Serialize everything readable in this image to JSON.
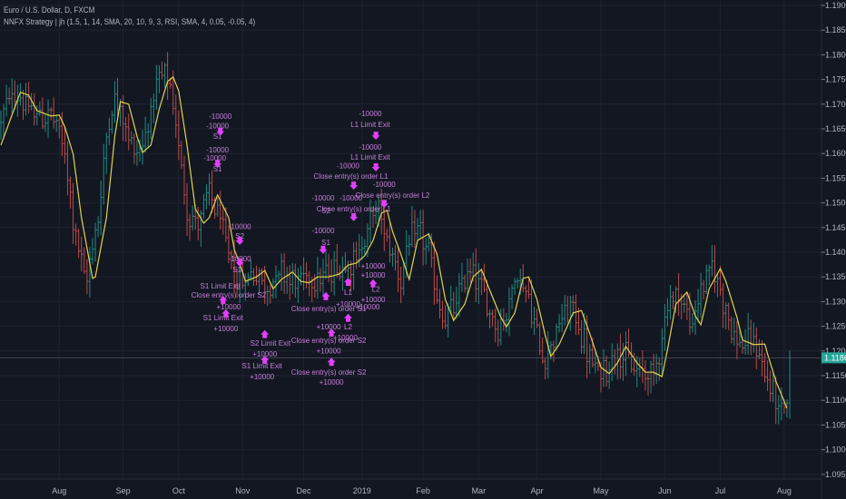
{
  "legend": {
    "symbol": "Euro / U.S. Dollar, D, FXCM",
    "study": "NNFX Strategy | jh (1.5, 1, 14, SMA, 20, 10, 9, 3, RSI, SMA, 4, 0.05, -0.05, 4)"
  },
  "colors": {
    "background": "#131722",
    "grid": "#1f2330",
    "up": "#22a094",
    "down": "#d9534f",
    "sma": "#e0d44a",
    "signal": "#e040fb",
    "last_price": "#26a69a"
  },
  "chart_data": {
    "type": "ohlc",
    "title": "Euro / U.S. Dollar, D, FXCM",
    "ylim": [
      1.095,
      1.19
    ],
    "price_ticks": [
      "1.19000",
      "1.18500",
      "1.18000",
      "1.17500",
      "1.17000",
      "1.16500",
      "1.16000",
      "1.15500",
      "1.15000",
      "1.14500",
      "1.14000",
      "1.13500",
      "1.13000",
      "1.12500",
      "1.12000",
      "1.11500",
      "1.11000",
      "1.10500",
      "1.10000",
      "1.09500"
    ],
    "time_ticks": [
      {
        "label": "Aug",
        "bar": 21
      },
      {
        "label": "Sep",
        "bar": 44
      },
      {
        "label": "Oct",
        "bar": 64
      },
      {
        "label": "Nov",
        "bar": 87
      },
      {
        "label": "Dec",
        "bar": 109
      },
      {
        "label": "2019",
        "bar": 130
      },
      {
        "label": "Feb",
        "bar": 152
      },
      {
        "label": "Mar",
        "bar": 172
      },
      {
        "label": "Apr",
        "bar": 193
      },
      {
        "label": "May",
        "bar": 216
      },
      {
        "label": "Jun",
        "bar": 239
      },
      {
        "label": "Jul",
        "bar": 259
      },
      {
        "label": "Aug",
        "bar": 282
      }
    ],
    "bar_count": 285,
    "last_price": "1.11861",
    "last_close": 1.11861,
    "sma_line": [
      [
        0,
        1.1617
      ],
      [
        7,
        1.1724
      ],
      [
        10,
        1.1718
      ],
      [
        13,
        1.1687
      ],
      [
        18,
        1.1676
      ],
      [
        21,
        1.1678
      ],
      [
        23,
        1.1654
      ],
      [
        26,
        1.1599
      ],
      [
        29,
        1.147
      ],
      [
        33,
        1.1347
      ],
      [
        34,
        1.135
      ],
      [
        38,
        1.147
      ],
      [
        41,
        1.1635
      ],
      [
        43,
        1.1705
      ],
      [
        46,
        1.17
      ],
      [
        49,
        1.1635
      ],
      [
        51,
        1.1602
      ],
      [
        54,
        1.1617
      ],
      [
        57,
        1.169
      ],
      [
        60,
        1.1746
      ],
      [
        62,
        1.1755
      ],
      [
        64,
        1.1727
      ],
      [
        67,
        1.1617
      ],
      [
        70,
        1.1488
      ],
      [
        73,
        1.1459
      ],
      [
        75,
        1.147
      ],
      [
        78,
        1.1516
      ],
      [
        82,
        1.147
      ],
      [
        84,
        1.1406
      ],
      [
        87,
        1.136
      ],
      [
        88,
        1.1341
      ],
      [
        92,
        1.135
      ],
      [
        95,
        1.1363
      ],
      [
        98,
        1.1326
      ],
      [
        101,
        1.1345
      ],
      [
        105,
        1.136
      ],
      [
        108,
        1.1341
      ],
      [
        111,
        1.1338
      ],
      [
        114,
        1.135
      ],
      [
        118,
        1.135
      ],
      [
        122,
        1.1356
      ],
      [
        125,
        1.1374
      ],
      [
        128,
        1.1378
      ],
      [
        131,
        1.1393
      ],
      [
        134,
        1.1424
      ],
      [
        137,
        1.1479
      ],
      [
        139,
        1.1485
      ],
      [
        141,
        1.1442
      ],
      [
        144,
        1.1396
      ],
      [
        147,
        1.1345
      ],
      [
        150,
        1.1424
      ],
      [
        154,
        1.1437
      ],
      [
        157,
        1.1396
      ],
      [
        160,
        1.1304
      ],
      [
        163,
        1.1262
      ],
      [
        167,
        1.1295
      ],
      [
        170,
        1.135
      ],
      [
        173,
        1.1365
      ],
      [
        176,
        1.1323
      ],
      [
        180,
        1.1268
      ],
      [
        182,
        1.1249
      ],
      [
        185,
        1.1277
      ],
      [
        188,
        1.1347
      ],
      [
        190,
        1.135
      ],
      [
        193,
        1.1304
      ],
      [
        196,
        1.1231
      ],
      [
        198,
        1.1189
      ],
      [
        201,
        1.1213
      ],
      [
        206,
        1.1277
      ],
      [
        209,
        1.1282
      ],
      [
        212,
        1.1235
      ],
      [
        216,
        1.1167
      ],
      [
        219,
        1.1154
      ],
      [
        222,
        1.1176
      ],
      [
        225,
        1.1209
      ],
      [
        229,
        1.1176
      ],
      [
        232,
        1.1157
      ],
      [
        235,
        1.1157
      ],
      [
        238,
        1.1148
      ],
      [
        240,
        1.1203
      ],
      [
        243,
        1.1295
      ],
      [
        247,
        1.1319
      ],
      [
        250,
        1.1271
      ],
      [
        252,
        1.1253
      ],
      [
        255,
        1.1326
      ],
      [
        259,
        1.1367
      ],
      [
        261,
        1.1341
      ],
      [
        265,
        1.1268
      ],
      [
        267,
        1.1222
      ],
      [
        271,
        1.1213
      ],
      [
        275,
        1.1214
      ],
      [
        276,
        1.1194
      ],
      [
        279,
        1.1139
      ],
      [
        283,
        1.1084
      ]
    ],
    "annotations": [
      {
        "text": "-10000",
        "bar": 79,
        "price": 1.1676
      },
      {
        "text": "-10000",
        "bar": 78,
        "price": 1.1656
      },
      {
        "text": "S1",
        "bar": 78,
        "price": 1.1635
      },
      {
        "text": "-10000",
        "bar": 78,
        "price": 1.1608
      },
      {
        "text": "-10000",
        "bar": 77,
        "price": 1.1591
      },
      {
        "text": "S1",
        "bar": 78,
        "price": 1.1569
      },
      {
        "text": "-10000",
        "bar": 86,
        "price": 1.1452
      },
      {
        "text": "S2",
        "bar": 86,
        "price": 1.1433
      },
      {
        "text": "-10000",
        "bar": 86,
        "price": 1.1387
      },
      {
        "text": "S1",
        "bar": 85,
        "price": 1.1365
      },
      {
        "text": "S1 Limit Exit",
        "bar": 79,
        "price": 1.1332
      },
      {
        "text": "Close entry(s) order S2",
        "bar": 82,
        "price": 1.1314
      },
      {
        "text": "+10000",
        "bar": 82,
        "price": 1.129
      },
      {
        "text": "S1 Limit Exit",
        "bar": 80,
        "price": 1.1268
      },
      {
        "text": "+10000",
        "bar": 81,
        "price": 1.1246
      },
      {
        "text": "S2 Limit Exit",
        "bar": 97,
        "price": 1.1216
      },
      {
        "text": "+10000",
        "bar": 95,
        "price": 1.1194
      },
      {
        "text": "S1 Limit Exit",
        "bar": 94,
        "price": 1.117
      },
      {
        "text": "+10000",
        "bar": 94,
        "price": 1.1148
      },
      {
        "text": "-10000",
        "bar": 133,
        "price": 1.1681
      },
      {
        "text": "L1 Limit Exit",
        "bar": 133,
        "price": 1.1659
      },
      {
        "text": "-10000",
        "bar": 133,
        "price": 1.1613
      },
      {
        "text": "L1 Limit Exit",
        "bar": 133,
        "price": 1.1593
      },
      {
        "text": "-10000",
        "bar": 125,
        "price": 1.1576
      },
      {
        "text": "Close entry(s) order L1",
        "bar": 126,
        "price": 1.1554
      },
      {
        "text": "-10000",
        "bar": 138,
        "price": 1.1538
      },
      {
        "text": "-10000",
        "bar": 116,
        "price": 1.151
      },
      {
        "text": "-10000",
        "bar": 126,
        "price": 1.151
      },
      {
        "text": "Close entry(s) order L2",
        "bar": 141,
        "price": 1.1516
      },
      {
        "text": "S2",
        "bar": 117,
        "price": 1.1485
      },
      {
        "text": "Close entry(s) order L1",
        "bar": 127,
        "price": 1.1488
      },
      {
        "text": "-10000",
        "bar": 116,
        "price": 1.1444
      },
      {
        "text": "S1",
        "bar": 117,
        "price": 1.142
      },
      {
        "text": "+10000",
        "bar": 134,
        "price": 1.1372
      },
      {
        "text": "+10000",
        "bar": 134,
        "price": 1.1354
      },
      {
        "text": "L1",
        "bar": 125,
        "price": 1.1319
      },
      {
        "text": "L2",
        "bar": 135,
        "price": 1.1326
      },
      {
        "text": "+10000",
        "bar": 134,
        "price": 1.1304
      },
      {
        "text": "+10000",
        "bar": 132,
        "price": 1.129
      },
      {
        "text": "+10000",
        "bar": 125,
        "price": 1.1295
      },
      {
        "text": "Close entry(s) order S1",
        "bar": 118,
        "price": 1.1286
      },
      {
        "text": "+10000",
        "bar": 118,
        "price": 1.1249
      },
      {
        "text": "L2",
        "bar": 125,
        "price": 1.1249
      },
      {
        "text": "+10000",
        "bar": 124,
        "price": 1.1227
      },
      {
        "text": "Close entry(s) order S2",
        "bar": 118,
        "price": 1.1222
      },
      {
        "text": "+10000",
        "bar": 118,
        "price": 1.1201
      },
      {
        "text": "Close entry(s) order S2",
        "bar": 118,
        "price": 1.1157
      },
      {
        "text": "+10000",
        "bar": 119,
        "price": 1.1137
      }
    ],
    "signal_arrows": [
      {
        "bar": 79,
        "price": 1.1643,
        "dir": "down"
      },
      {
        "bar": 78,
        "price": 1.1578,
        "dir": "down"
      },
      {
        "bar": 86,
        "price": 1.1422,
        "dir": "down"
      },
      {
        "bar": 86,
        "price": 1.1378,
        "dir": "down"
      },
      {
        "bar": 80,
        "price": 1.1304,
        "dir": "up"
      },
      {
        "bar": 81,
        "price": 1.1277,
        "dir": "up"
      },
      {
        "bar": 95,
        "price": 1.1235,
        "dir": "up"
      },
      {
        "bar": 95,
        "price": 1.1183,
        "dir": "up"
      },
      {
        "bar": 135,
        "price": 1.1635,
        "dir": "down"
      },
      {
        "bar": 135,
        "price": 1.1571,
        "dir": "down"
      },
      {
        "bar": 127,
        "price": 1.1534,
        "dir": "down"
      },
      {
        "bar": 127,
        "price": 1.147,
        "dir": "down"
      },
      {
        "bar": 138,
        "price": 1.1497,
        "dir": "down"
      },
      {
        "bar": 116,
        "price": 1.1404,
        "dir": "down"
      },
      {
        "bar": 117,
        "price": 1.1312,
        "dir": "up"
      },
      {
        "bar": 125,
        "price": 1.1341,
        "dir": "up"
      },
      {
        "bar": 125,
        "price": 1.1268,
        "dir": "up"
      },
      {
        "bar": 119,
        "price": 1.1238,
        "dir": "up"
      },
      {
        "bar": 119,
        "price": 1.1179,
        "dir": "up"
      },
      {
        "bar": 134,
        "price": 1.1338,
        "dir": "up"
      }
    ]
  }
}
